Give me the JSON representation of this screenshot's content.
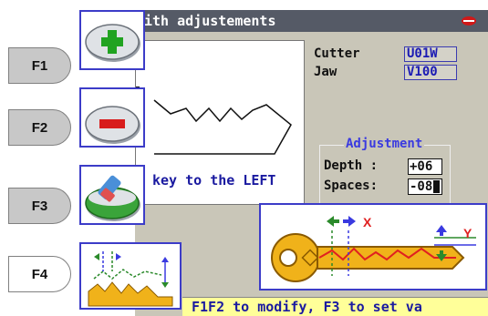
{
  "function_keys": [
    "F1",
    "F2",
    "F3",
    "F4"
  ],
  "title": "ith adjustements",
  "info": {
    "cutter_label": "Cutter",
    "cutter_value": "U01W",
    "jaw_label": "Jaw",
    "jaw_value": "V100"
  },
  "viewport_hint": "key to the LEFT",
  "adjustment": {
    "title": "Adjustment",
    "depth_label": "Depth :",
    "depth_value": "+06",
    "spaces_label": "Spaces:",
    "spaces_value": "-08"
  },
  "axis_labels": {
    "x": "X",
    "y": "Y"
  },
  "status": "F1F2 to modify, F3 to set va",
  "icons": {
    "f1": "plus-icon",
    "f2": "minus-icon",
    "f3": "eraser-icon",
    "f4": "key-adjust-icon"
  },
  "colors": {
    "titlebar": "#555a66",
    "screen": "#c9c6b8",
    "value_text": "#1a1ab4",
    "status_bg": "#ffff99",
    "button_border": "#3c3cc8"
  }
}
